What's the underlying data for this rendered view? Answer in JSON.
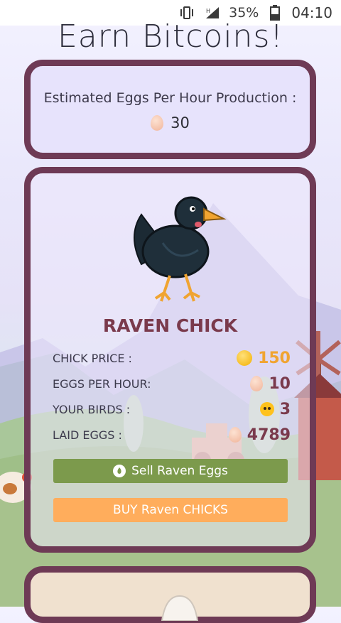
{
  "status_bar": {
    "battery": "35%",
    "time": "04:10"
  },
  "page": {
    "title": "Earn Bitcoins!"
  },
  "production": {
    "label": "Estimated Eggs Per Hour Production :",
    "value": "30"
  },
  "raven": {
    "name": "RAVEN CHICK",
    "rows": [
      {
        "label": "CHICK PRICE :",
        "value": "150",
        "icon": "coin-icon"
      },
      {
        "label": "EGGS PER HOUR:",
        "value": "10",
        "icon": "egg-icon"
      },
      {
        "label": "YOUR BIRDS :",
        "value": "3",
        "icon": "chick-icon"
      },
      {
        "label": "LAID EGGS :",
        "value": "4789",
        "icon": "egg-icon"
      }
    ],
    "sell_label": "Sell Raven Eggs",
    "buy_label": "BUY Raven CHICKS"
  },
  "colors": {
    "card_border": "#6e3a55",
    "sell_button": "#7c9a4c",
    "buy_button": "#ffad5c",
    "price_text": "#f0a431",
    "value_text": "#7a3a4c"
  }
}
